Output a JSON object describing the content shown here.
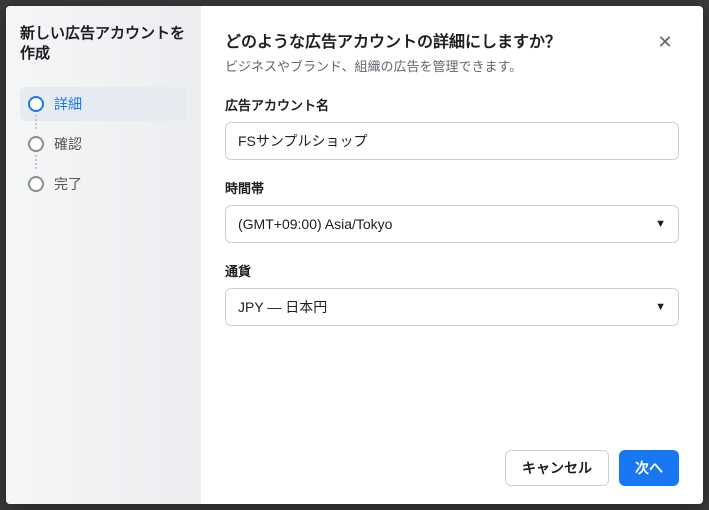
{
  "sidebar": {
    "title": "新しい広告アカウントを作成",
    "steps": [
      {
        "label": "詳細"
      },
      {
        "label": "確認"
      },
      {
        "label": "完了"
      }
    ]
  },
  "header": {
    "title": "どのような広告アカウントの詳細にしますか？",
    "subtitle": "ビジネスやブランド、組織の広告を管理できます。"
  },
  "fields": {
    "account_name": {
      "label": "広告アカウント名",
      "value": "FSサンプルショップ"
    },
    "timezone": {
      "label": "時間帯",
      "value": "(GMT+09:00) Asia/Tokyo"
    },
    "currency": {
      "label": "通貨",
      "value": "JPY — 日本円"
    }
  },
  "buttons": {
    "cancel": "キャンセル",
    "next": "次へ"
  }
}
